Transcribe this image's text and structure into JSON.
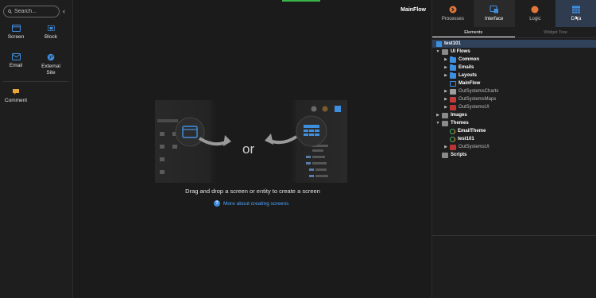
{
  "toolbox": {
    "search_placeholder": "Search...",
    "collapse_glyph": "‹",
    "items": [
      {
        "label": "Screen",
        "icon": "screen-icon"
      },
      {
        "label": "Block",
        "icon": "block-icon"
      },
      {
        "label": "Email",
        "icon": "email-icon"
      },
      {
        "label": "External Site",
        "icon": "external-site-icon"
      },
      {
        "label": "Comment",
        "icon": "comment-icon"
      }
    ]
  },
  "canvas": {
    "flow_name": "MainFlow",
    "or_text": "or",
    "drag_text": "Drag and drop a screen or entity to create a screen",
    "more_link": "More about creating screens",
    "help_glyph": "?"
  },
  "panel": {
    "tabs": [
      {
        "label": "Processes",
        "icon": "processes-icon"
      },
      {
        "label": "Interface",
        "icon": "interface-icon"
      },
      {
        "label": "Logic",
        "icon": "logic-icon"
      },
      {
        "label": "Data",
        "icon": "data-icon"
      }
    ],
    "active_tab": "Interface",
    "subtabs": [
      "Elements",
      "Widget Tree"
    ],
    "active_subtab": "Elements",
    "tree": [
      {
        "label": "test101",
        "level": 0,
        "twisty": "",
        "icon": "app-icon",
        "style": "bold",
        "selected": true
      },
      {
        "label": "UI Flows",
        "level": 0,
        "twisty": "▼",
        "icon": "ui-flows-icon",
        "style": "bold"
      },
      {
        "label": "Common",
        "level": 1,
        "twisty": "▶",
        "icon": "folder-icon",
        "style": "bold"
      },
      {
        "label": "Emails",
        "level": 1,
        "twisty": "▶",
        "icon": "folder-icon",
        "style": "bold"
      },
      {
        "label": "Layouts",
        "level": 1,
        "twisty": "▶",
        "icon": "folder-icon",
        "style": "bold"
      },
      {
        "label": "MainFlow",
        "level": 1,
        "twisty": "",
        "icon": "flow-folder-icon",
        "style": "bold"
      },
      {
        "label": "OutSystemsCharts",
        "level": 1,
        "twisty": "▶",
        "icon": "module-icon",
        "style": "dim"
      },
      {
        "label": "OutSystemsMaps",
        "level": 1,
        "twisty": "▶",
        "icon": "maps-module-icon",
        "style": "dim"
      },
      {
        "label": "OutSystemsUI",
        "level": 1,
        "twisty": "▶",
        "icon": "ui-module-icon",
        "style": "dim"
      },
      {
        "label": "Images",
        "level": 0,
        "twisty": "▶",
        "icon": "images-folder-icon",
        "style": "bold"
      },
      {
        "label": "Themes",
        "level": 0,
        "twisty": "▼",
        "icon": "themes-folder-icon",
        "style": "bold"
      },
      {
        "label": "EmailTheme",
        "level": 1,
        "twisty": "",
        "icon": "theme-icon",
        "style": "bold"
      },
      {
        "label": "test101",
        "level": 1,
        "twisty": "",
        "icon": "theme-icon",
        "style": "bold"
      },
      {
        "label": "OutSystemsUI",
        "level": 1,
        "twisty": "▶",
        "icon": "ui-module-icon",
        "style": "dim"
      },
      {
        "label": "Scripts",
        "level": 0,
        "twisty": "",
        "icon": "scripts-folder-icon",
        "style": "bold"
      }
    ]
  },
  "colors": {
    "accent_blue": "#3f8fe0",
    "selected_row": "#30415a",
    "link": "#4aa3ff",
    "green_indicator": "#3bb54a"
  }
}
